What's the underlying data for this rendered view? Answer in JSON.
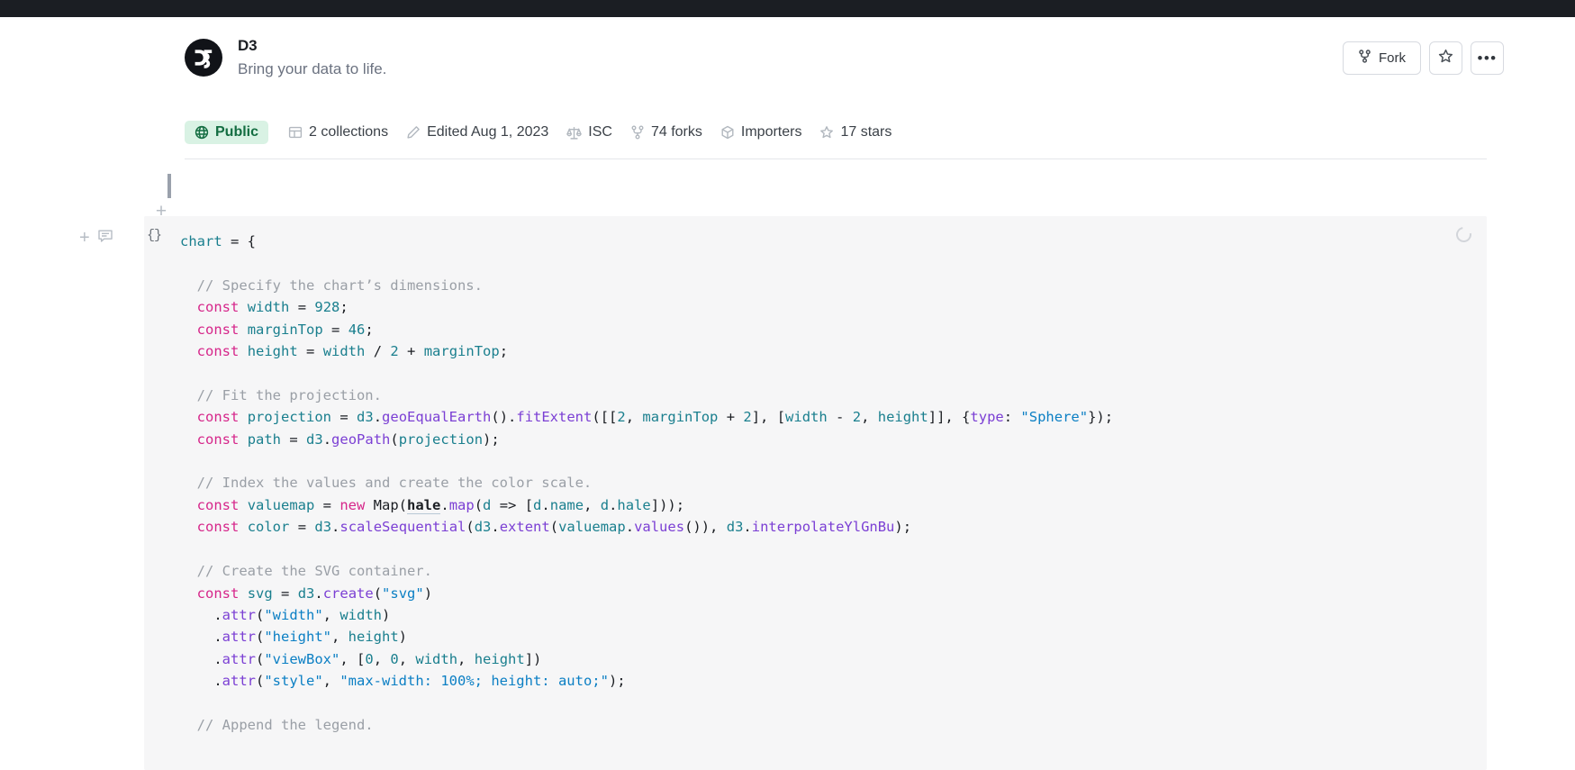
{
  "notebook": {
    "title": "D3",
    "subtitle": "Bring your data to life.",
    "logo_text": "D3",
    "logo_icon": "d3-logo-icon"
  },
  "header_actions": {
    "fork_label": "Fork",
    "fork_icon": "fork-icon",
    "star_icon": "star-icon",
    "more_label": "•••",
    "more_icon": "ellipsis-icon"
  },
  "meta": [
    {
      "label": "Public",
      "icon": "globe-icon",
      "badge": true
    },
    {
      "label": "2 collections",
      "icon": "collections-icon",
      "badge": false
    },
    {
      "label": "Edited Aug 1, 2023",
      "icon": "pencil-icon",
      "badge": false
    },
    {
      "label": "ISC",
      "icon": "license-scale-icon",
      "badge": false
    },
    {
      "label": "74 forks",
      "icon": "fork-icon",
      "badge": false
    },
    {
      "label": "Importers",
      "icon": "package-icon",
      "badge": false
    },
    {
      "label": "17 stars",
      "icon": "star-icon",
      "badge": false
    }
  ],
  "gutter": {
    "add_cell_top_icon": "plus-icon",
    "add_cell_icon": "plus-icon",
    "comment_icon": "comment-icon",
    "cell_type_label": "{}",
    "cell_type_icon": "code-braces-icon",
    "spinner_icon": "loading-spinner-icon"
  },
  "code_cell": {
    "lines": [
      {
        "indent": 0,
        "tokens": [
          {
            "t": "chart",
            "c": "tok-var"
          },
          {
            "t": " = {",
            "c": "tok-pl"
          }
        ]
      },
      {
        "indent": 0,
        "tokens": []
      },
      {
        "indent": 1,
        "tokens": [
          {
            "t": "// Specify the chart’s dimensions.",
            "c": "tok-com"
          }
        ]
      },
      {
        "indent": 1,
        "tokens": [
          {
            "t": "const",
            "c": "tok-kw"
          },
          {
            "t": " ",
            "c": "tok-pl"
          },
          {
            "t": "width",
            "c": "tok-var"
          },
          {
            "t": " = ",
            "c": "tok-pl"
          },
          {
            "t": "928",
            "c": "tok-num"
          },
          {
            "t": ";",
            "c": "tok-pl"
          }
        ]
      },
      {
        "indent": 1,
        "tokens": [
          {
            "t": "const",
            "c": "tok-kw"
          },
          {
            "t": " ",
            "c": "tok-pl"
          },
          {
            "t": "marginTop",
            "c": "tok-var"
          },
          {
            "t": " = ",
            "c": "tok-pl"
          },
          {
            "t": "46",
            "c": "tok-num"
          },
          {
            "t": ";",
            "c": "tok-pl"
          }
        ]
      },
      {
        "indent": 1,
        "tokens": [
          {
            "t": "const",
            "c": "tok-kw"
          },
          {
            "t": " ",
            "c": "tok-pl"
          },
          {
            "t": "height",
            "c": "tok-var"
          },
          {
            "t": " = ",
            "c": "tok-pl"
          },
          {
            "t": "width",
            "c": "tok-var"
          },
          {
            "t": " / ",
            "c": "tok-pl"
          },
          {
            "t": "2",
            "c": "tok-num"
          },
          {
            "t": " + ",
            "c": "tok-pl"
          },
          {
            "t": "marginTop",
            "c": "tok-var"
          },
          {
            "t": ";",
            "c": "tok-pl"
          }
        ]
      },
      {
        "indent": 0,
        "tokens": []
      },
      {
        "indent": 1,
        "tokens": [
          {
            "t": "// Fit the projection.",
            "c": "tok-com"
          }
        ]
      },
      {
        "indent": 1,
        "tokens": [
          {
            "t": "const",
            "c": "tok-kw"
          },
          {
            "t": " ",
            "c": "tok-pl"
          },
          {
            "t": "projection",
            "c": "tok-var"
          },
          {
            "t": " = ",
            "c": "tok-pl"
          },
          {
            "t": "d3",
            "c": "tok-d3"
          },
          {
            "t": ".",
            "c": "tok-pl"
          },
          {
            "t": "geoEqualEarth",
            "c": "tok-fn"
          },
          {
            "t": "().",
            "c": "tok-pl"
          },
          {
            "t": "fitExtent",
            "c": "tok-fn"
          },
          {
            "t": "([[",
            "c": "tok-pl"
          },
          {
            "t": "2",
            "c": "tok-num"
          },
          {
            "t": ", ",
            "c": "tok-pl"
          },
          {
            "t": "marginTop",
            "c": "tok-var"
          },
          {
            "t": " + ",
            "c": "tok-pl"
          },
          {
            "t": "2",
            "c": "tok-num"
          },
          {
            "t": "], [",
            "c": "tok-pl"
          },
          {
            "t": "width",
            "c": "tok-var"
          },
          {
            "t": " - ",
            "c": "tok-pl"
          },
          {
            "t": "2",
            "c": "tok-num"
          },
          {
            "t": ", ",
            "c": "tok-pl"
          },
          {
            "t": "height",
            "c": "tok-var"
          },
          {
            "t": "]], {",
            "c": "tok-pl"
          },
          {
            "t": "type",
            "c": "tok-key"
          },
          {
            "t": ": ",
            "c": "tok-pl"
          },
          {
            "t": "\"Sphere\"",
            "c": "tok-str"
          },
          {
            "t": "});",
            "c": "tok-pl"
          }
        ]
      },
      {
        "indent": 1,
        "tokens": [
          {
            "t": "const",
            "c": "tok-kw"
          },
          {
            "t": " ",
            "c": "tok-pl"
          },
          {
            "t": "path",
            "c": "tok-var"
          },
          {
            "t": " = ",
            "c": "tok-pl"
          },
          {
            "t": "d3",
            "c": "tok-d3"
          },
          {
            "t": ".",
            "c": "tok-pl"
          },
          {
            "t": "geoPath",
            "c": "tok-fn"
          },
          {
            "t": "(",
            "c": "tok-pl"
          },
          {
            "t": "projection",
            "c": "tok-var"
          },
          {
            "t": ");",
            "c": "tok-pl"
          }
        ]
      },
      {
        "indent": 0,
        "tokens": []
      },
      {
        "indent": 1,
        "tokens": [
          {
            "t": "// Index the values and create the color scale.",
            "c": "tok-com"
          }
        ]
      },
      {
        "indent": 1,
        "tokens": [
          {
            "t": "const",
            "c": "tok-kw"
          },
          {
            "t": " ",
            "c": "tok-pl"
          },
          {
            "t": "valuemap",
            "c": "tok-var"
          },
          {
            "t": " = ",
            "c": "tok-pl"
          },
          {
            "t": "new",
            "c": "tok-kw"
          },
          {
            "t": " Map(",
            "c": "tok-pl"
          },
          {
            "t": "hale",
            "c": "tok-ref"
          },
          {
            "t": ".",
            "c": "tok-pl"
          },
          {
            "t": "map",
            "c": "tok-fn"
          },
          {
            "t": "(",
            "c": "tok-pl"
          },
          {
            "t": "d",
            "c": "tok-var"
          },
          {
            "t": " => [",
            "c": "tok-pl"
          },
          {
            "t": "d",
            "c": "tok-var"
          },
          {
            "t": ".",
            "c": "tok-pl"
          },
          {
            "t": "name",
            "c": "tok-var"
          },
          {
            "t": ", ",
            "c": "tok-pl"
          },
          {
            "t": "d",
            "c": "tok-var"
          },
          {
            "t": ".",
            "c": "tok-pl"
          },
          {
            "t": "hale",
            "c": "tok-var"
          },
          {
            "t": "]));",
            "c": "tok-pl"
          }
        ]
      },
      {
        "indent": 1,
        "tokens": [
          {
            "t": "const",
            "c": "tok-kw"
          },
          {
            "t": " ",
            "c": "tok-pl"
          },
          {
            "t": "color",
            "c": "tok-var"
          },
          {
            "t": " = ",
            "c": "tok-pl"
          },
          {
            "t": "d3",
            "c": "tok-d3"
          },
          {
            "t": ".",
            "c": "tok-pl"
          },
          {
            "t": "scaleSequential",
            "c": "tok-fn"
          },
          {
            "t": "(",
            "c": "tok-pl"
          },
          {
            "t": "d3",
            "c": "tok-d3"
          },
          {
            "t": ".",
            "c": "tok-pl"
          },
          {
            "t": "extent",
            "c": "tok-fn"
          },
          {
            "t": "(",
            "c": "tok-pl"
          },
          {
            "t": "valuemap",
            "c": "tok-var"
          },
          {
            "t": ".",
            "c": "tok-pl"
          },
          {
            "t": "values",
            "c": "tok-fn"
          },
          {
            "t": "()), ",
            "c": "tok-pl"
          },
          {
            "t": "d3",
            "c": "tok-d3"
          },
          {
            "t": ".",
            "c": "tok-pl"
          },
          {
            "t": "interpolateYlGnBu",
            "c": "tok-fn"
          },
          {
            "t": ");",
            "c": "tok-pl"
          }
        ]
      },
      {
        "indent": 0,
        "tokens": []
      },
      {
        "indent": 1,
        "tokens": [
          {
            "t": "// Create the SVG container.",
            "c": "tok-com"
          }
        ]
      },
      {
        "indent": 1,
        "tokens": [
          {
            "t": "const",
            "c": "tok-kw"
          },
          {
            "t": " ",
            "c": "tok-pl"
          },
          {
            "t": "svg",
            "c": "tok-var"
          },
          {
            "t": " = ",
            "c": "tok-pl"
          },
          {
            "t": "d3",
            "c": "tok-d3"
          },
          {
            "t": ".",
            "c": "tok-pl"
          },
          {
            "t": "create",
            "c": "tok-fn"
          },
          {
            "t": "(",
            "c": "tok-pl"
          },
          {
            "t": "\"svg\"",
            "c": "tok-str"
          },
          {
            "t": ")",
            "c": "tok-pl"
          }
        ]
      },
      {
        "indent": 2,
        "tokens": [
          {
            "t": ".",
            "c": "tok-pl"
          },
          {
            "t": "attr",
            "c": "tok-fn"
          },
          {
            "t": "(",
            "c": "tok-pl"
          },
          {
            "t": "\"width\"",
            "c": "tok-str"
          },
          {
            "t": ", ",
            "c": "tok-pl"
          },
          {
            "t": "width",
            "c": "tok-var"
          },
          {
            "t": ")",
            "c": "tok-pl"
          }
        ]
      },
      {
        "indent": 2,
        "tokens": [
          {
            "t": ".",
            "c": "tok-pl"
          },
          {
            "t": "attr",
            "c": "tok-fn"
          },
          {
            "t": "(",
            "c": "tok-pl"
          },
          {
            "t": "\"height\"",
            "c": "tok-str"
          },
          {
            "t": ", ",
            "c": "tok-pl"
          },
          {
            "t": "height",
            "c": "tok-var"
          },
          {
            "t": ")",
            "c": "tok-pl"
          }
        ]
      },
      {
        "indent": 2,
        "tokens": [
          {
            "t": ".",
            "c": "tok-pl"
          },
          {
            "t": "attr",
            "c": "tok-fn"
          },
          {
            "t": "(",
            "c": "tok-pl"
          },
          {
            "t": "\"viewBox\"",
            "c": "tok-str"
          },
          {
            "t": ", [",
            "c": "tok-pl"
          },
          {
            "t": "0",
            "c": "tok-num"
          },
          {
            "t": ", ",
            "c": "tok-pl"
          },
          {
            "t": "0",
            "c": "tok-num"
          },
          {
            "t": ", ",
            "c": "tok-pl"
          },
          {
            "t": "width",
            "c": "tok-var"
          },
          {
            "t": ", ",
            "c": "tok-pl"
          },
          {
            "t": "height",
            "c": "tok-var"
          },
          {
            "t": "])",
            "c": "tok-pl"
          }
        ]
      },
      {
        "indent": 2,
        "tokens": [
          {
            "t": ".",
            "c": "tok-pl"
          },
          {
            "t": "attr",
            "c": "tok-fn"
          },
          {
            "t": "(",
            "c": "tok-pl"
          },
          {
            "t": "\"style\"",
            "c": "tok-str"
          },
          {
            "t": ", ",
            "c": "tok-pl"
          },
          {
            "t": "\"max-width: 100%; height: auto;\"",
            "c": "tok-str"
          },
          {
            "t": ");",
            "c": "tok-pl"
          }
        ]
      },
      {
        "indent": 0,
        "tokens": []
      },
      {
        "indent": 1,
        "tokens": [
          {
            "t": "// Append the legend.",
            "c": "tok-com"
          }
        ]
      }
    ]
  },
  "colors": {
    "topbar": "#1b1e23",
    "badge_bg": "#d9f2e4",
    "badge_text": "#136d41",
    "code_bg": "#f6f6f7",
    "keyword": "#d6268a",
    "string": "#0b7fc4",
    "function": "#7b3fd4",
    "variable": "#1a7f8e",
    "comment": "#9a9fa6"
  }
}
